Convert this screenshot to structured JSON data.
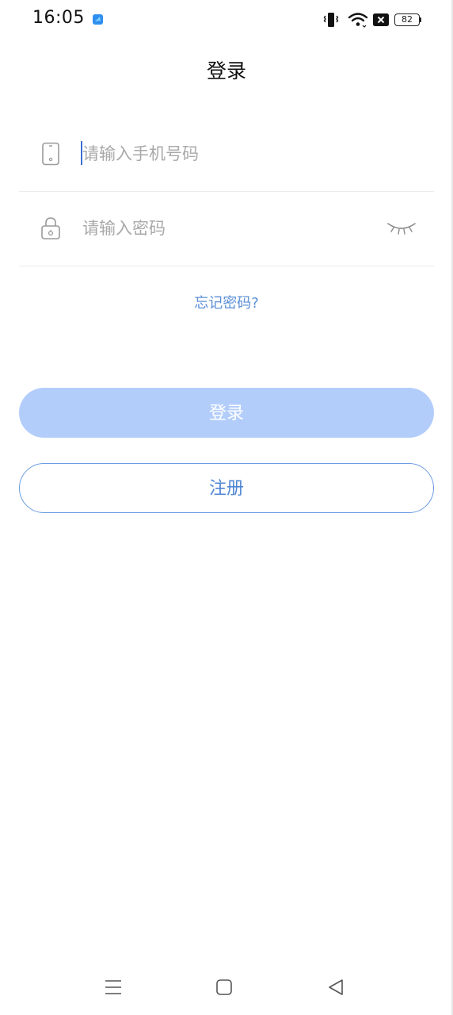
{
  "status_bar": {
    "time": "16:05",
    "battery_level": "82",
    "icons": [
      "app-notification-icon",
      "vibrate-icon",
      "wifi-icon",
      "no-sim-icon",
      "battery-icon"
    ]
  },
  "header": {
    "title": "登录"
  },
  "form": {
    "phone_placeholder": "请输入手机号码",
    "phone_value": "",
    "phone_icon": "phone-icon",
    "password_placeholder": "请输入密码",
    "password_value": "",
    "password_icon": "lock-icon",
    "visibility_icon": "eye-closed-icon"
  },
  "links": {
    "forgot_password": "忘记密码?"
  },
  "buttons": {
    "login_label": "登录",
    "register_label": "注册"
  },
  "nav_bar": {
    "icons": [
      "menu-icon",
      "home-icon",
      "back-icon"
    ]
  },
  "colors": {
    "accent": "#4f86d4",
    "login_button_bg": "#b3cdfb",
    "link": "#5b8fd6",
    "placeholder": "#a9a9a9"
  }
}
